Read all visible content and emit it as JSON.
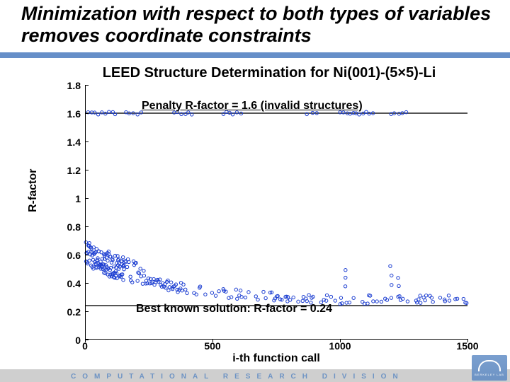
{
  "slide_title": "Minimization with respect to both types of variables removes coordinate constraints",
  "footer": "COMPUTATIONAL RESEARCH DIVISION",
  "logo_label": "BERKELEY LAB",
  "chart_data": {
    "type": "scatter",
    "title": "LEED Structure Determination for Ni(001)-(5×5)-Li",
    "xlabel": "i-th function call",
    "ylabel": "R-factor",
    "xlim": [
      0,
      1500
    ],
    "ylim": [
      0,
      1.8
    ],
    "xticks": [
      0,
      500,
      1000,
      1500
    ],
    "yticks": [
      0,
      0.2,
      0.4,
      0.6,
      0.8,
      1,
      1.2,
      1.4,
      1.6,
      1.8
    ],
    "reference_lines": [
      0.24,
      1.6
    ],
    "annotations": {
      "top": "Penalty R-factor = 1.6 (invalid structures)",
      "bottom": "Best known solution: R-factor = 0.24"
    },
    "invalid_band_y": 1.6,
    "invalid_band_x_clusters": [
      [
        10,
        120
      ],
      [
        160,
        220
      ],
      [
        350,
        420
      ],
      [
        540,
        610
      ],
      [
        870,
        910
      ],
      [
        1000,
        1130
      ],
      [
        1200,
        1260
      ]
    ],
    "scatter_trend": {
      "x_range": [
        5,
        1500
      ],
      "y_start_range": [
        0.45,
        0.65
      ],
      "y_mid_range_at_300": [
        0.3,
        0.45
      ],
      "y_end_range_at_1500": [
        0.24,
        0.3
      ],
      "spikes": [
        {
          "x": 1020,
          "y": 0.48
        },
        {
          "x": 1200,
          "y": 0.5
        },
        {
          "x": 1230,
          "y": 0.42
        }
      ]
    }
  }
}
